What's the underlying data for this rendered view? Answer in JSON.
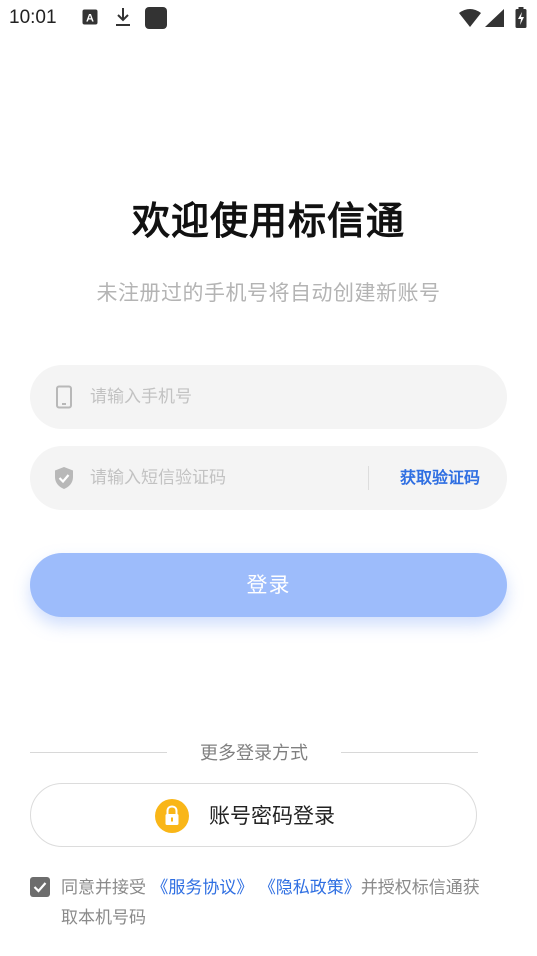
{
  "status_bar": {
    "time": "10:01",
    "icons": [
      "font-app-icon",
      "download-icon",
      "app-square-icon",
      "wifi-icon",
      "signal-icon",
      "battery-charging-icon"
    ]
  },
  "page": {
    "title": "欢迎使用标信通",
    "subtitle": "未注册过的手机号将自动创建新账号"
  },
  "phone_input": {
    "placeholder": "请输入手机号",
    "value": "",
    "icon": "phone-icon"
  },
  "code_input": {
    "placeholder": "请输入短信验证码",
    "value": "",
    "icon": "shield-check-icon",
    "get_code_label": "获取验证码"
  },
  "login_button": {
    "label": "登录"
  },
  "more_login": {
    "label": "更多登录方式",
    "account_password_label": "账号密码登录",
    "icon": "lock-icon"
  },
  "agreement": {
    "checked": true,
    "prefix": "同意并接受",
    "service_link": "《服务协议》",
    "privacy_link": "《隐私政策》",
    "suffix": "并授权标信通获取本机号码"
  },
  "colors": {
    "accent": "#2f6fe2",
    "login_button_bg": "#9dbcfb",
    "input_bg": "#f4f4f4",
    "lock_bg": "#f9b618"
  }
}
